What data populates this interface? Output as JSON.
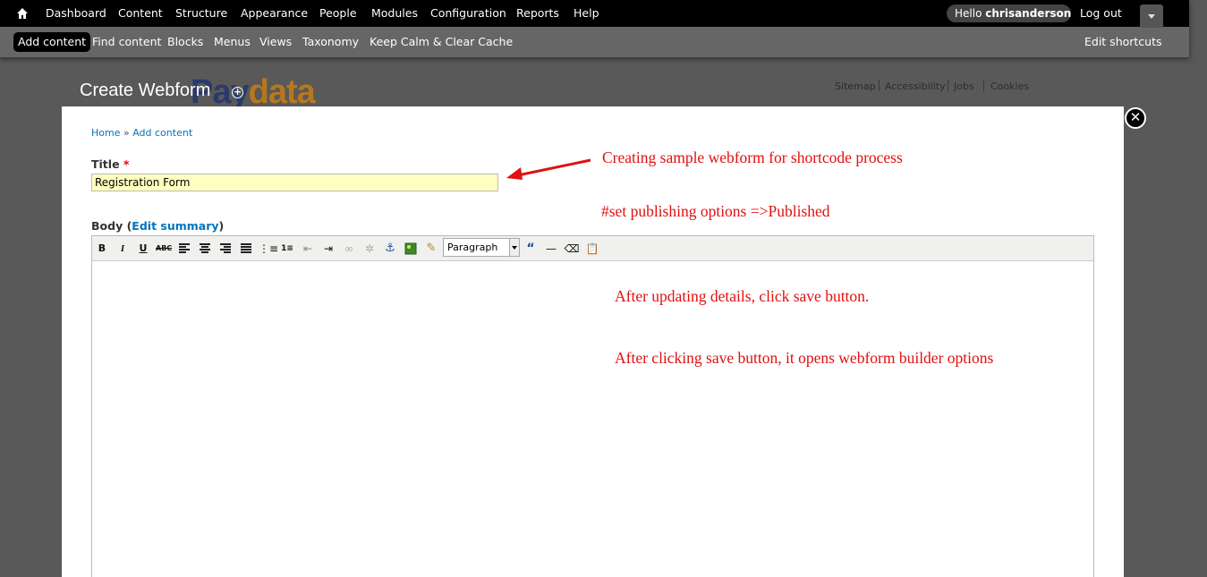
{
  "admin_menu": {
    "items": [
      "Dashboard",
      "Content",
      "Structure",
      "Appearance",
      "People",
      "Modules",
      "Configuration",
      "Reports",
      "Help"
    ],
    "hello_prefix": "Hello",
    "username": "chrisanderson",
    "logout": "Log out"
  },
  "shortcuts": {
    "items": [
      "Add content",
      "Find content",
      "Blocks",
      "Menus",
      "Views",
      "Taxonomy",
      "Keep Calm & Clear Cache"
    ],
    "edit_label": "Edit shortcuts"
  },
  "background_page": {
    "title": "Create Webform",
    "logo_part1": "Pay",
    "logo_part2": "data",
    "top_links": [
      "Sitemap",
      "Accessibility",
      "Jobs",
      "Cookies"
    ]
  },
  "breadcrumb": {
    "home": "Home",
    "separator": "»",
    "current": "Add content"
  },
  "form": {
    "title_label": "Title",
    "required_marker": "*",
    "title_value": "Registration Form",
    "body_label": "Body",
    "edit_summary": "Edit summary",
    "format_value": "Paragraph"
  },
  "annotations": {
    "note1": "Creating sample webform for shortcode process",
    "note2": "#set publishing options =>Published",
    "note3": "After updating details, click save button.",
    "note4": "After clicking save button, it opens webform builder options"
  },
  "colors": {
    "annotation": "#e01010",
    "link": "#0074bd",
    "input_bg": "#ffffc0"
  }
}
